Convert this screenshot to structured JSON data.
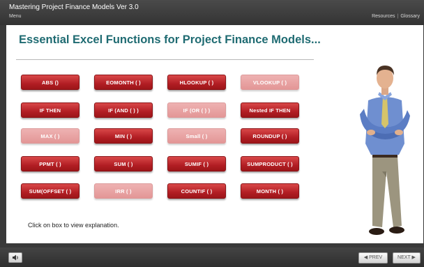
{
  "header": {
    "app_title": "Mastering Project Finance Models Ver 3.0",
    "menu_label": "Menu",
    "resources_label": "Resources",
    "separator": "|",
    "glossary_label": "Glossary"
  },
  "slide": {
    "title": "Essential Excel Functions for Project Finance Models...",
    "instruction": "Click on box to view explanation.",
    "buttons": [
      {
        "label": "ABS ()",
        "state": "active"
      },
      {
        "label": "EOMONTH ( )",
        "state": "active"
      },
      {
        "label": "HLOOKUP ( )",
        "state": "active"
      },
      {
        "label": "VLOOKUP ( )",
        "state": "faded"
      },
      {
        "label": "IF THEN",
        "state": "active"
      },
      {
        "label": "IF (AND ( ) )",
        "state": "active"
      },
      {
        "label": "IF (OR ( ) )",
        "state": "faded"
      },
      {
        "label": "Nested IF THEN",
        "state": "active"
      },
      {
        "label": "MAX ( )",
        "state": "faded"
      },
      {
        "label": "MIN ( )",
        "state": "active"
      },
      {
        "label": "Small ( )",
        "state": "faded"
      },
      {
        "label": "ROUNDUP ( )",
        "state": "active"
      },
      {
        "label": "PPMT ( )",
        "state": "active"
      },
      {
        "label": "SUM ( )",
        "state": "active"
      },
      {
        "label": "SUMIF ( )",
        "state": "active"
      },
      {
        "label": "SUMPRODUCT ( )",
        "state": "active"
      },
      {
        "label": "SUM(OFFSET ( )",
        "state": "active"
      },
      {
        "label": "IRR ( )",
        "state": "faded"
      },
      {
        "label": "COUNTIF ( )",
        "state": "active"
      },
      {
        "label": "MONTH ( )",
        "state": "active"
      }
    ]
  },
  "footer": {
    "audio_icon": "speaker-icon",
    "prev_label": "PREV",
    "next_label": "NEXT"
  },
  "colors": {
    "title_teal": "#1f6b72",
    "button_dark": "#b21e24",
    "button_light": "#e39696"
  }
}
